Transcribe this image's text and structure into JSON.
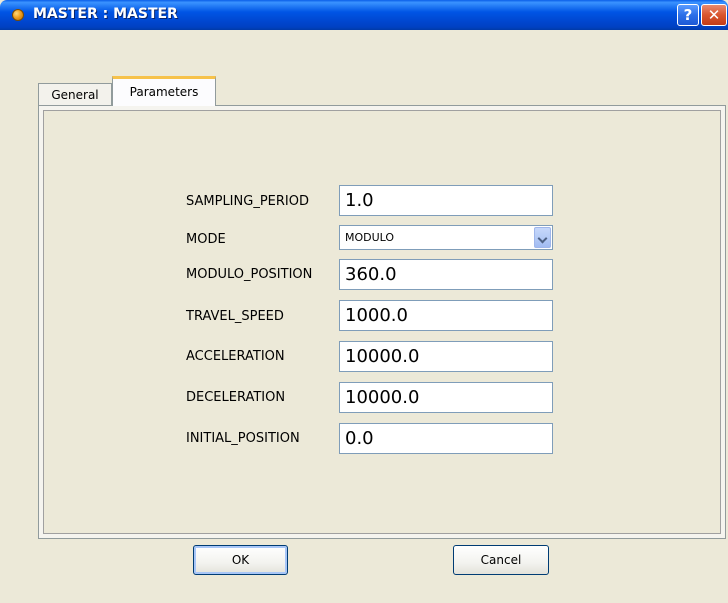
{
  "window": {
    "title": "MASTER : MASTER",
    "help_label": "?",
    "close_label": "✕"
  },
  "tabs": [
    {
      "label": "General",
      "active": false
    },
    {
      "label": "Parameters",
      "active": true
    }
  ],
  "form": {
    "sampling_period": {
      "label": "SAMPLING_PERIOD",
      "value": "1.0"
    },
    "mode": {
      "label": "MODE",
      "value": "MODULO"
    },
    "modulo_position": {
      "label": "MODULO_POSITION",
      "value": "360.0"
    },
    "travel_speed": {
      "label": "TRAVEL_SPEED",
      "value": "1000.0"
    },
    "acceleration": {
      "label": "ACCELERATION",
      "value": "10000.0"
    },
    "deceleration": {
      "label": "DECELERATION",
      "value": "10000.0"
    },
    "initial_position": {
      "label": "INITIAL_POSITION",
      "value": "0.0"
    }
  },
  "buttons": {
    "ok": "OK",
    "cancel": "Cancel"
  },
  "colors": {
    "titlebar": "#0055e5",
    "window_bg": "#ece9d8",
    "active_tab_accent": "#f6c24b"
  },
  "icons": {
    "app": "app-icon",
    "help": "help-icon",
    "close": "close-icon",
    "dropdown": "chevron-down-icon"
  }
}
